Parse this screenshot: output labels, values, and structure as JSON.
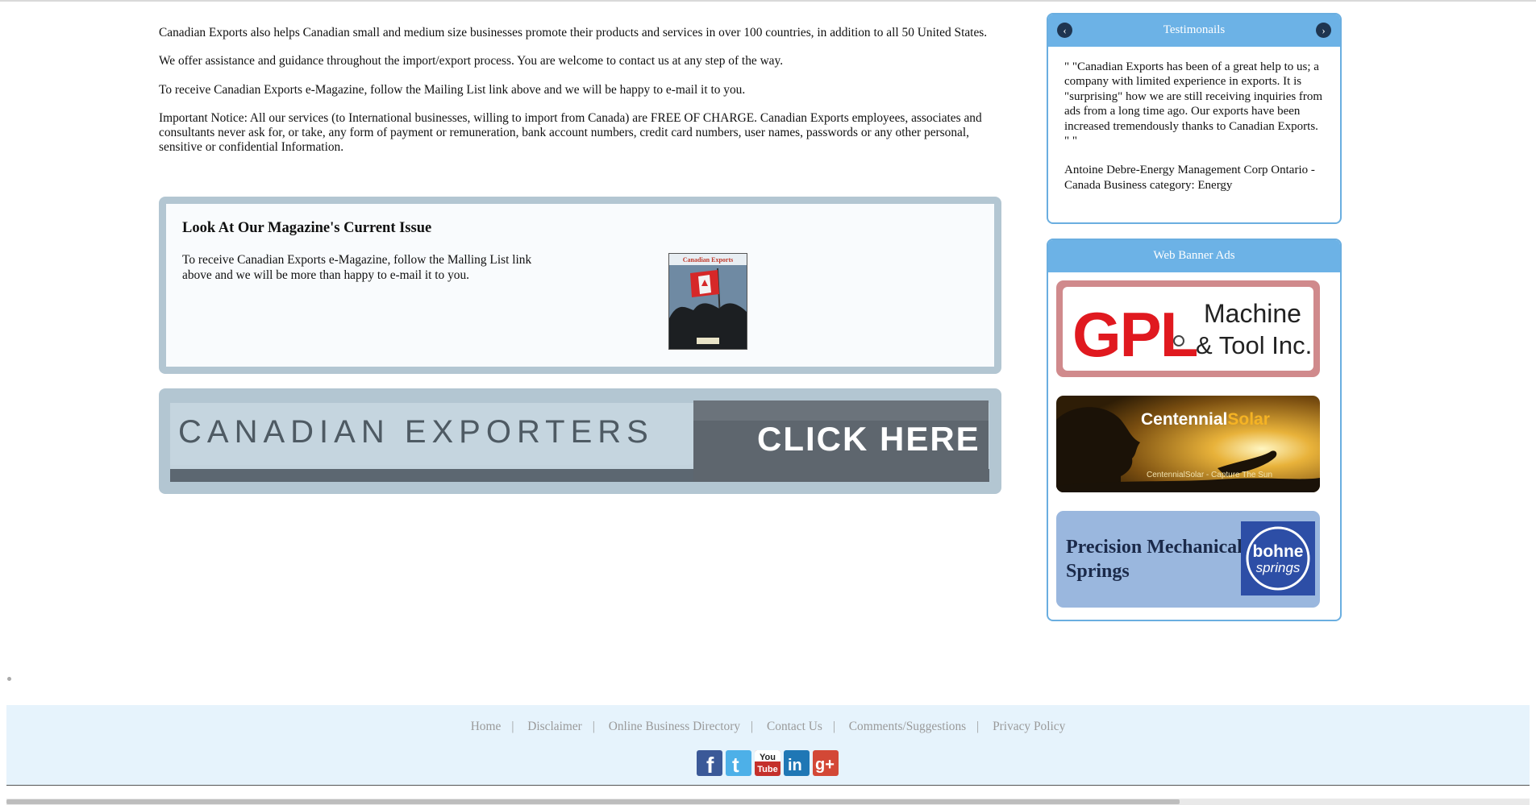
{
  "main": {
    "paragraphs": [
      "Canadian Exports also helps Canadian small and medium size businesses promote their products and services in over 100 countries, in addition to all 50 United States.",
      "We offer assistance and guidance throughout the import/export process. You are welcome to contact us at any step of the way.",
      "To receive Canadian Exports e-Magazine, follow the Mailing List link above and we will be happy to e-mail it to you.",
      "Important Notice: All our services (to International businesses, willing to import from Canada) are FREE OF CHARGE. Canadian Exports employees, associates and consultants never ask for, or take, any form of payment or remuneration, bank account numbers, credit card numbers, user names, passwords or any other personal, sensitive or confidential Information."
    ],
    "magazine": {
      "title": "Look At Our Magazine's Current Issue",
      "text": "To receive Canadian Exports e-Magazine, follow the Malling List link above and we will be more than happy to e-mail it to you.",
      "cover_title": "Canadian Exports"
    },
    "exporters_banner": {
      "left_text": "CANADIAN EXPORTERS",
      "right_text": "CLICK HERE"
    }
  },
  "sidebar": {
    "testimonials": {
      "title": "Testimonails",
      "quote": "\" \"Canadian Exports has been of a great help to us; a company with limited experience in exports. It is \"surprising\" how we are still receiving inquiries from ads from a long time ago. Our exports have been increased tremendously thanks to Canadian Exports. \" \"",
      "author": "Antoine Debre-Energy Management Corp Ontario - Canada Business category: Energy",
      "prev_icon": "chevron-left-icon",
      "next_icon": "chevron-right-icon"
    },
    "ads": {
      "title": "Web Banner Ads",
      "gpl": {
        "logo": "GPL",
        "line1": "Machine",
        "line2": "& Tool Inc."
      },
      "centennial": {
        "brand_a": "Centennial",
        "brand_b": "Solar",
        "tagline": "CentennialSolar - Capture The Sun"
      },
      "bohne": {
        "line1": "Precision Mechanical",
        "line2": "Springs",
        "logo_a": "bohne",
        "logo_b": "springs"
      }
    }
  },
  "footer": {
    "links": [
      "Home",
      "Disclaimer",
      "Online Business Directory",
      "Contact Us",
      "Comments/Suggestions",
      "Privacy Policy"
    ],
    "social": [
      {
        "name": "facebook-icon",
        "glyph": "f",
        "color": "#3b5998"
      },
      {
        "name": "twitter-icon",
        "glyph": "t",
        "color": "#4db0e8"
      },
      {
        "name": "youtube-icon",
        "glyph": "You Tube",
        "color": "#c4302b"
      },
      {
        "name": "linkedin-icon",
        "glyph": "in",
        "color": "#1f77b5"
      },
      {
        "name": "googleplus-icon",
        "glyph": "g+",
        "color": "#d34836"
      }
    ]
  },
  "colors": {
    "panel_header": "#6cb2e6",
    "panel_border": "#6aaee0",
    "box_frame": "#b3c6d2",
    "footer_bg": "#e6f3fc",
    "link_gray": "#9a9a9a"
  }
}
